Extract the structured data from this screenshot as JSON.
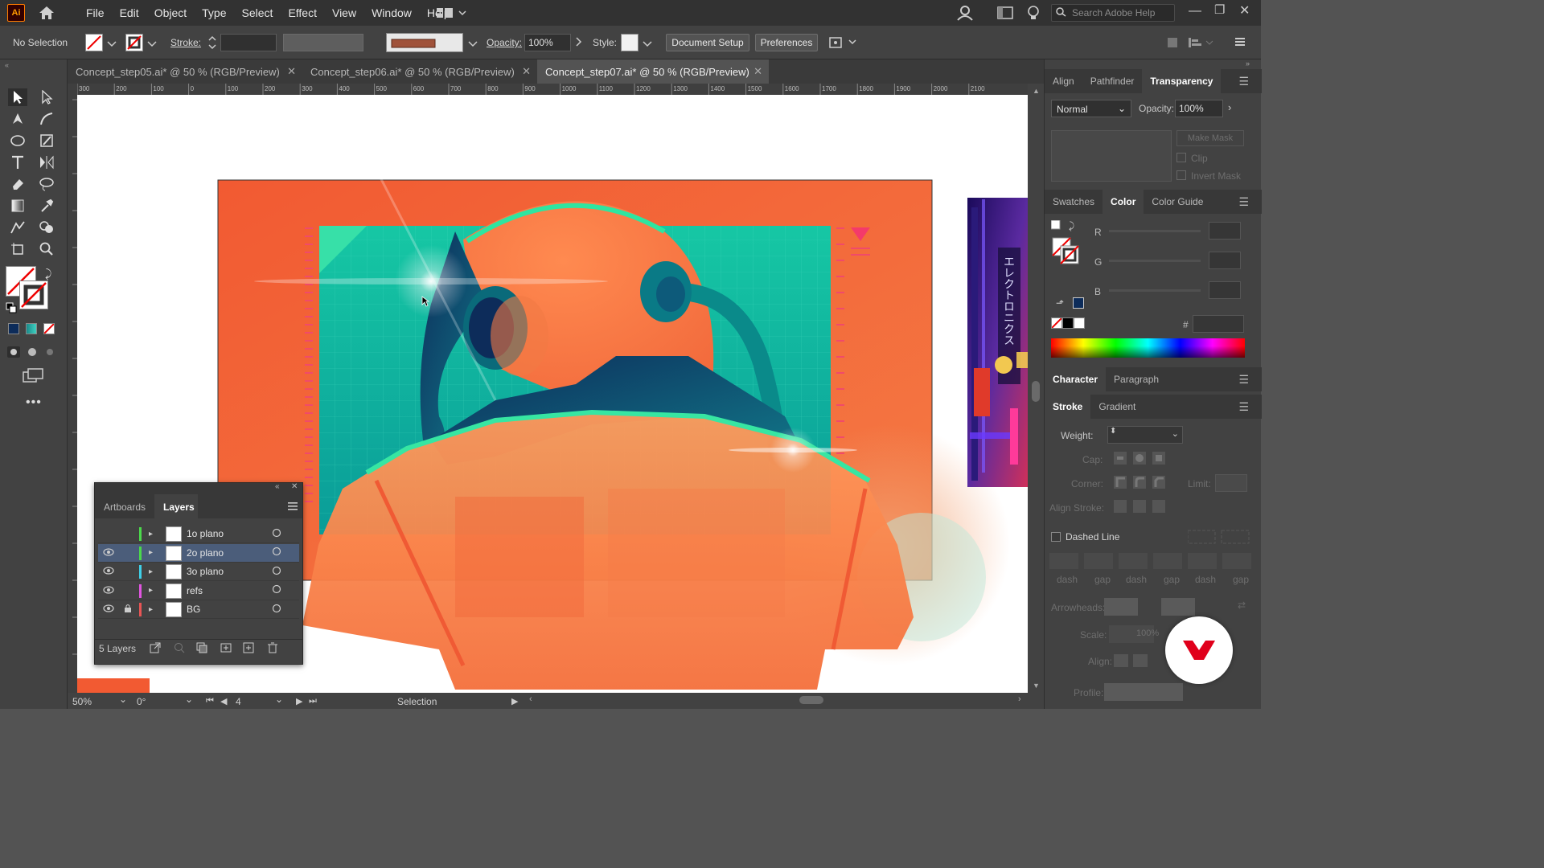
{
  "app": {
    "logo": "Ai",
    "home_icon": "home-icon"
  },
  "menu": [
    "File",
    "Edit",
    "Object",
    "Type",
    "Select",
    "Effect",
    "View",
    "Window",
    "Help"
  ],
  "search": {
    "placeholder": "Search Adobe Help"
  },
  "control_bar": {
    "selection": "No Selection",
    "stroke_label": "Stroke:",
    "opacity_label": "Opacity:",
    "opacity_value": "100%",
    "style_label": "Style:",
    "document_setup": "Document Setup",
    "preferences": "Preferences"
  },
  "tabs": [
    {
      "label": "Concept_step05.ai* @ 50 % (RGB/Preview)",
      "active": false
    },
    {
      "label": "Concept_step06.ai* @ 50 % (RGB/Preview)",
      "active": false
    },
    {
      "label": "Concept_step07.ai* @ 50 % (RGB/Preview)",
      "active": true
    }
  ],
  "ruler_ticks": [
    "300",
    "200",
    "100",
    "0",
    "100",
    "200",
    "300",
    "400",
    "500",
    "600",
    "700",
    "800",
    "900",
    "1000",
    "1100",
    "1200",
    "1300",
    "1400",
    "1500",
    "1600",
    "1700",
    "1800",
    "1900",
    "2000",
    "2100"
  ],
  "layers_panel": {
    "tabs": [
      "Artboards",
      "Layers"
    ],
    "layers": [
      {
        "name": "1o plano",
        "color": "#4bd94b",
        "visible": false,
        "locked": false
      },
      {
        "name": "2o plano",
        "color": "#4bd94b",
        "visible": true,
        "locked": false
      },
      {
        "name": "3o plano",
        "color": "#3fd0e8",
        "visible": true,
        "locked": false
      },
      {
        "name": "refs",
        "color": "#e055e0",
        "visible": true,
        "locked": false
      },
      {
        "name": "BG",
        "color": "#e85555",
        "visible": true,
        "locked": true
      }
    ],
    "count": "5 Layers"
  },
  "transparency_panel": {
    "tabs": [
      "Align",
      "Pathfinder",
      "Transparency"
    ],
    "blend_mode": "Normal",
    "opacity_label": "Opacity:",
    "opacity_value": "100%",
    "make_mask": "Make Mask",
    "clip": "Clip",
    "invert_mask": "Invert Mask"
  },
  "color_panel": {
    "tabs": [
      "Swatches",
      "Color",
      "Color Guide"
    ],
    "channels": [
      "R",
      "G",
      "B"
    ],
    "hex_label": "#"
  },
  "char_panel": {
    "tabs": [
      "Character",
      "Paragraph"
    ]
  },
  "stroke_panel": {
    "tabs": [
      "Stroke",
      "Gradient"
    ],
    "weight_label": "Weight:",
    "cap_label": "Cap:",
    "corner_label": "Corner:",
    "limit_label": "Limit:",
    "align_stroke_label": "Align Stroke:",
    "dashed_line": "Dashed Line",
    "dash_labels": [
      "dash",
      "gap",
      "dash",
      "gap",
      "dash",
      "gap"
    ],
    "arrowheads_label": "Arrowheads:",
    "scale_label": "Scale:",
    "scale_value": "100%",
    "align_label": "Align:",
    "profile_label": "Profile:"
  },
  "status": {
    "zoom": "50%",
    "rotation": "0°",
    "artboard": "4",
    "tool": "Selection"
  },
  "artwork_text": "エレクトロニクス",
  "colors": {
    "accent_orange": "#f26a3c",
    "teal": "#16c9a3",
    "dark_blue": "#0d2c5a",
    "red_badge": "#e0001b"
  }
}
